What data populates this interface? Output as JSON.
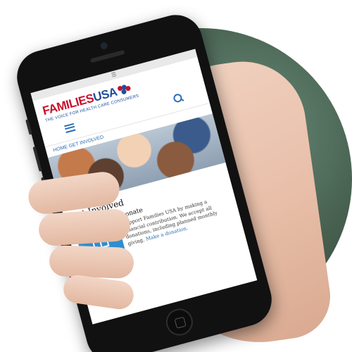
{
  "status_bar": {
    "menu_glyph": "☰"
  },
  "header": {
    "logo_families": "FAMILIES",
    "logo_usa": "USA",
    "tagline": "THE VOICE FOR HEALTH CARE CONSUMERS"
  },
  "nav": {
    "menu_icon": "menu-icon",
    "search_icon": "search-icon"
  },
  "link_row": {
    "text": "HOME  GET INVOLVED"
  },
  "get_involved": {
    "title": "Get Involved",
    "donate_title": "Donate",
    "donate_text": "Support Families USA by making a financial contribution. We accept all donations, including planned monthly giving.",
    "donate_link": "Make a donation."
  },
  "colors": {
    "brand_red": "#c8102e",
    "brand_blue": "#1f4e9c",
    "link_blue": "#2a6db3",
    "tile_blue": "#2d8fd0"
  }
}
